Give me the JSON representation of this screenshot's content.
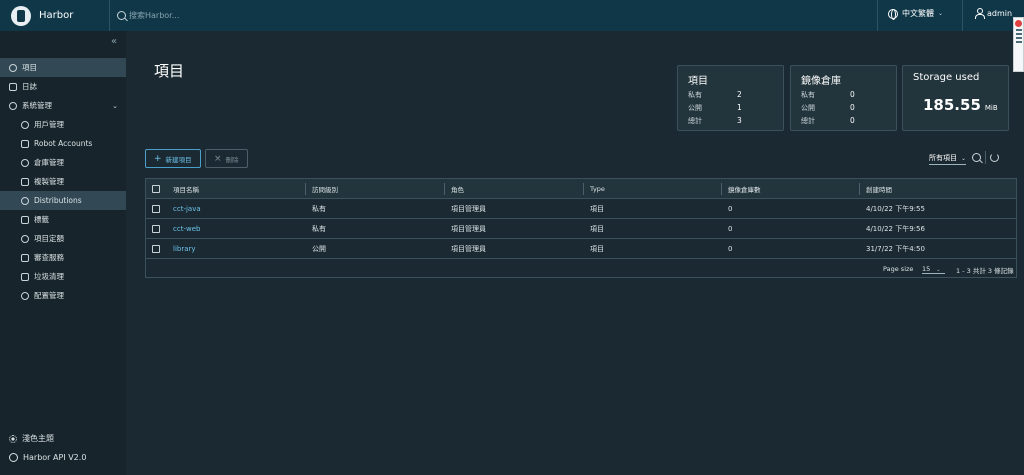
{
  "header": {
    "app_title": "Harbor",
    "search_placeholder": "搜索Harbor...",
    "language": "中文繁體",
    "username": "admin"
  },
  "sidebar": {
    "items": [
      {
        "label": "項目",
        "icon": "user-icon"
      },
      {
        "label": "日誌",
        "icon": "log-icon"
      },
      {
        "label": "系統管理",
        "icon": "admin-icon"
      },
      {
        "label": "用戶管理",
        "icon": "users-icon"
      },
      {
        "label": "Robot Accounts",
        "icon": "robot-icon"
      },
      {
        "label": "倉庫管理",
        "icon": "registry-icon"
      },
      {
        "label": "複製管理",
        "icon": "replication-icon"
      },
      {
        "label": "Distributions",
        "icon": "share-icon"
      },
      {
        "label": "標籤",
        "icon": "tag-icon"
      },
      {
        "label": "項目定額",
        "icon": "quota-icon"
      },
      {
        "label": "審查服務",
        "icon": "shield-icon"
      },
      {
        "label": "垃圾清理",
        "icon": "trash-icon"
      },
      {
        "label": "配置管理",
        "icon": "gear-icon"
      }
    ],
    "theme_label": "淺色主題",
    "api_label": "Harbor API V2.0"
  },
  "main": {
    "title": "項目",
    "cards": {
      "projects": {
        "title": "項目",
        "rows": [
          {
            "label": "私有",
            "value": "2"
          },
          {
            "label": "公開",
            "value": "1"
          },
          {
            "label": "總計",
            "value": "3"
          }
        ]
      },
      "repos": {
        "title": "鏡像倉庫",
        "rows": [
          {
            "label": "私有",
            "value": "0"
          },
          {
            "label": "公開",
            "value": "0"
          },
          {
            "label": "總計",
            "value": "0"
          }
        ]
      },
      "storage": {
        "title": "Storage used",
        "value": "185.55",
        "unit": "MiB"
      }
    },
    "buttons": {
      "new_project": "新建項目",
      "delete": "刪除"
    },
    "filter": {
      "selected": "所有項目"
    },
    "table": {
      "headers": [
        "項目名稱",
        "訪問級別",
        "角色",
        "Type",
        "鏡像倉庫數",
        "創建時間"
      ],
      "rows": [
        [
          "cct-java",
          "私有",
          "項目管理員",
          "項目",
          "0",
          "4/10/22 下午9:55"
        ],
        [
          "cct-web",
          "私有",
          "項目管理員",
          "項目",
          "0",
          "4/10/22 下午9:56"
        ],
        [
          "library",
          "公開",
          "項目管理員",
          "項目",
          "0",
          "31/7/22 下午4:50"
        ]
      ],
      "page_size_label": "Page size",
      "page_size": "15",
      "page_count": "1 - 3 共計 3 條記錄"
    }
  }
}
